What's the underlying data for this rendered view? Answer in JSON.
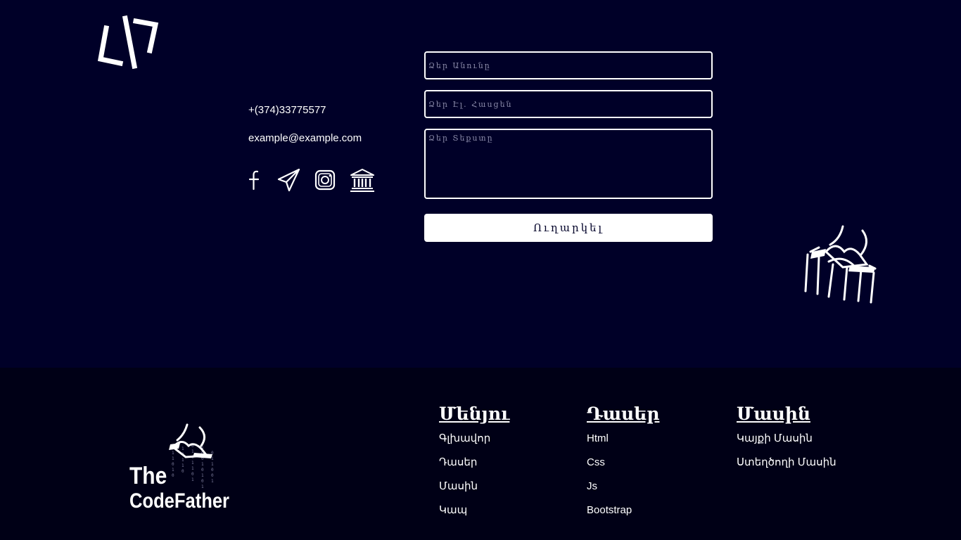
{
  "contact": {
    "phone": "+(374)33775577",
    "email": "example@example.com",
    "socials": [
      "facebook-icon",
      "telegram-icon",
      "instagram-icon",
      "bank-icon"
    ]
  },
  "form": {
    "name_placeholder": "Ձեր Անունը",
    "email_placeholder": "Ձեր Էլ. Հասցեն",
    "message_placeholder": "Ձեր Տեքստը",
    "submit_label": "Ուղարկել"
  },
  "footer": {
    "logo_text_line1": "The",
    "logo_text_line2": "CodeFather",
    "menu": {
      "title": "Մենյու",
      "items": [
        "Գլխավոր",
        "Դասեր",
        "Մասին",
        "Կապ"
      ]
    },
    "lessons": {
      "title": "Դասեր",
      "items": [
        "Html",
        "Css",
        "Js",
        "Bootstrap"
      ]
    },
    "about": {
      "title": "Մասին",
      "items": [
        "Կայքի Մասին",
        "Ստեղծողի Մասին"
      ]
    }
  },
  "colors": {
    "background": "#000028",
    "footer_background": "#000016",
    "text": "#ffffff"
  }
}
